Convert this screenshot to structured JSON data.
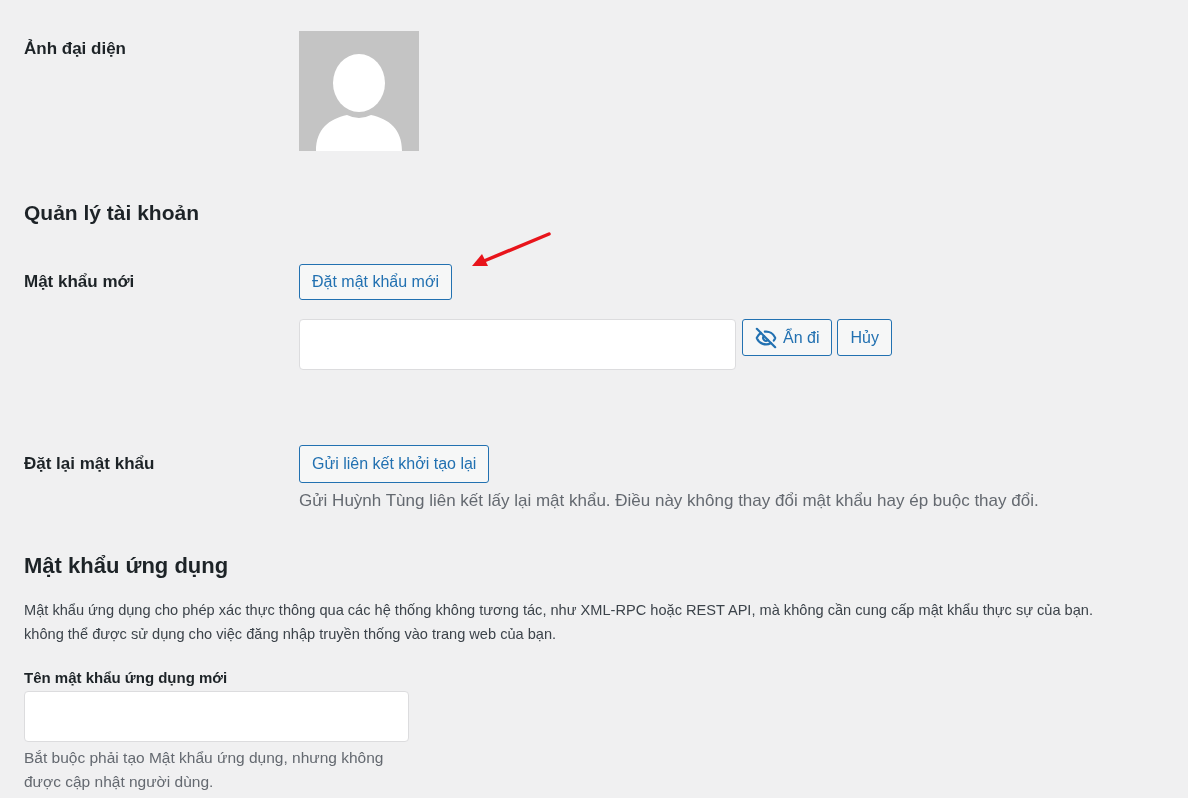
{
  "profile_picture": {
    "label": "Ảnh đại diện"
  },
  "account_management": {
    "heading": "Quản lý tài khoản",
    "new_password": {
      "label": "Mật khẩu mới",
      "set_button": "Đặt mật khẩu mới",
      "hide_button": "Ẩn đi",
      "cancel_button": "Hủy"
    },
    "reset_password": {
      "label": "Đặt lại mật khẩu",
      "button": "Gửi liên kết khởi tạo lại",
      "description": "Gửi Huỳnh Tùng liên kết lấy lại mật khẩu. Điều này không thay đổi mật khẩu hay ép buộc thay đổi."
    }
  },
  "application_passwords": {
    "heading": "Mật khẩu ứng dụng",
    "description_lines": [
      "Mật khẩu ứng dụng cho phép xác thực thông qua các hệ thống không tương tác, như XML-RPC hoặc REST API, mà không cần cung cấp mật khẩu thực sự của bạn.",
      "không thể được sử dụng cho việc đăng nhập truyền thống vào trang web của bạn."
    ],
    "new_name": {
      "label": "Tên mật khẩu ứng dụng mới",
      "description": "Bắt buộc phải tạo Mật khẩu ứng dụng, nhưng không được cập nhật người dùng."
    }
  }
}
